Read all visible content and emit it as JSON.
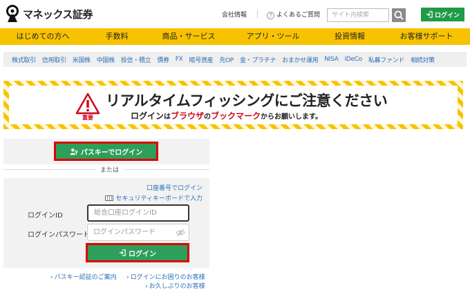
{
  "header": {
    "logo_text": "マネックス証券",
    "company_info": "会社情報",
    "faq": "よくあるご質問",
    "search_placeholder": "サイト内検索",
    "login_label": "ログイン"
  },
  "main_nav": [
    {
      "label": "はじめての方へ"
    },
    {
      "label": "手数料"
    },
    {
      "label": "商品・サービス"
    },
    {
      "label": "アプリ・ツール"
    },
    {
      "label": "投資情報"
    },
    {
      "label": "お客様サポート"
    }
  ],
  "sub_nav": [
    {
      "label": "株式取引"
    },
    {
      "label": "信用取引"
    },
    {
      "label": "米国株"
    },
    {
      "label": "中国株"
    },
    {
      "label": "投信・積立"
    },
    {
      "label": "債券"
    },
    {
      "label": "FX"
    },
    {
      "label": "暗号資産"
    },
    {
      "label": "先OP"
    },
    {
      "label": "金・プラチナ"
    },
    {
      "label": "おまかせ運用"
    },
    {
      "label": "NISA"
    },
    {
      "label": "iDeCo"
    },
    {
      "label": "私募ファンド"
    },
    {
      "label": "相続対策"
    }
  ],
  "banner": {
    "warning_label": "重要",
    "title_main": "リアルタイムフィッシング",
    "title_tail": "にご注意ください",
    "sub_1": "ログイン",
    "sub_2": "は",
    "sub_3": "ブラウザ",
    "sub_4": "の",
    "sub_5": "ブックマーク",
    "sub_6": "からお願いします。"
  },
  "login": {
    "passkey_button": "パスキーでログイン",
    "or_text": "または",
    "account_number_link": "口座番号でログイン",
    "security_keyboard_link": "セキュリティキーボードで入力",
    "id_label": "ログインID",
    "id_placeholder": "総合口座ログインID",
    "pw_label": "ログインパスワード",
    "pw_placeholder": "ログインパスワード",
    "login_button": "ログイン"
  },
  "bottom_links": {
    "passkey_info": "パスキー認証のご案内",
    "login_trouble": "ログインにお困りのお客様",
    "long_time": "お久しぶりのお客様"
  },
  "colors": {
    "brand_yellow": "#f7c300",
    "green": "#2e9e5b",
    "highlight_red": "#e00000",
    "link_blue": "#2b6fb6"
  }
}
